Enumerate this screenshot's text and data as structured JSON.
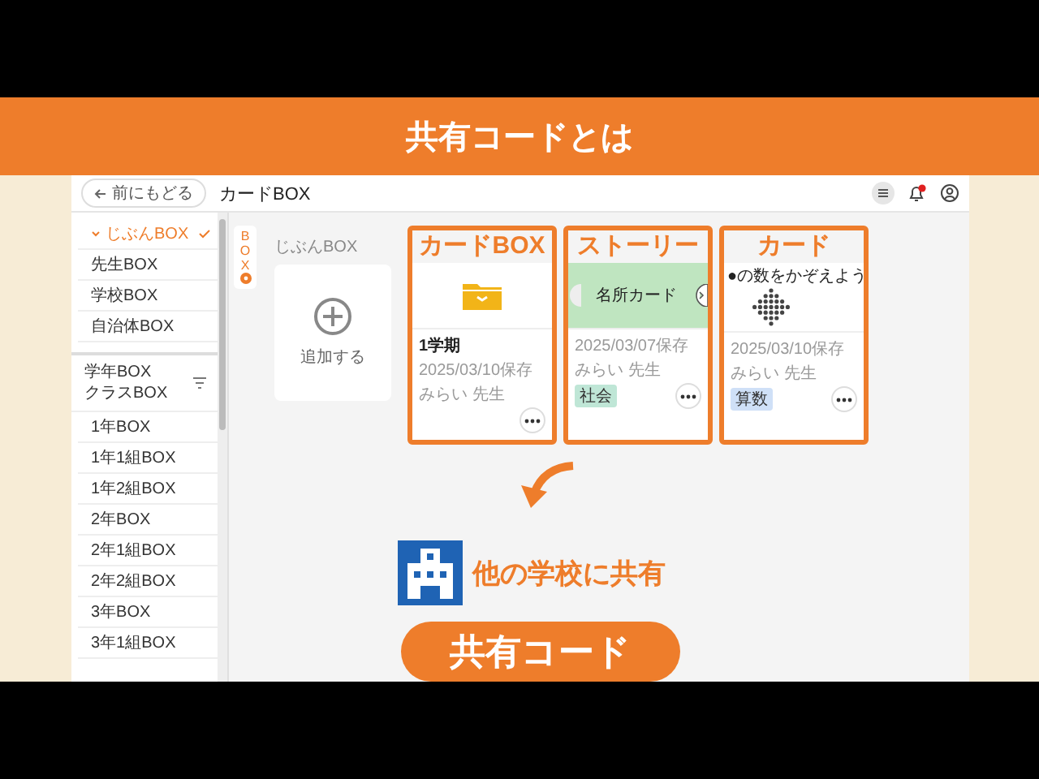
{
  "banner": {
    "title": "共有コードとは"
  },
  "header": {
    "back_button": "前にもどる",
    "title": "カードBOX"
  },
  "sidebar": {
    "items": [
      {
        "label": "じぶんBOX",
        "selected": true
      },
      {
        "label": "先生BOX",
        "selected": false
      },
      {
        "label": "学校BOX",
        "selected": false
      },
      {
        "label": "自治体BOX",
        "selected": false
      }
    ],
    "group_title": [
      "学年BOX",
      "クラスBOX"
    ],
    "group_items": [
      {
        "label": "1年BOX",
        "selected": false
      },
      {
        "label": "1年1組BOX",
        "selected": false
      },
      {
        "label": "1年2組BOX",
        "selected": false
      },
      {
        "label": "2年BOX",
        "selected": false
      },
      {
        "label": "2年1組BOX",
        "selected": false
      },
      {
        "label": "2年2組BOX",
        "selected": false
      },
      {
        "label": "3年BOX",
        "selected": false
      },
      {
        "label": "3年1組BOX",
        "selected": false
      }
    ]
  },
  "box_tab": {
    "label": "BOX"
  },
  "main": {
    "section_label": "じぶんBOX",
    "add_card": {
      "label": "追加する"
    },
    "cards": [
      {
        "kind": "folder",
        "callout": "カードBOX",
        "title": "1学期",
        "date": "2025/03/10保存",
        "author": "みらい 先生"
      },
      {
        "kind": "story",
        "callout": "ストーリー",
        "thumb_text": "名所カード",
        "date": "2025/03/07保存",
        "author": "みらい 先生",
        "tag": {
          "label": "社会",
          "color": "#bfe6d6"
        }
      },
      {
        "kind": "card",
        "callout": "カード",
        "thumb_text": "●の数をかぞえよう",
        "date": "2025/03/10保存",
        "author": "みらい 先生",
        "tag": {
          "label": "算数",
          "color": "#cfe0f7"
        }
      }
    ]
  },
  "share": {
    "label": "他の学校に共有",
    "button": "共有コード"
  }
}
